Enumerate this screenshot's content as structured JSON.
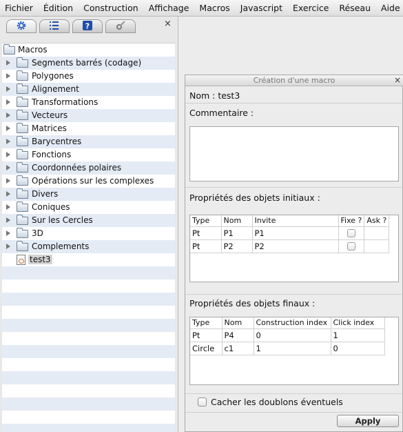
{
  "menubar": [
    "Fichier",
    "Édition",
    "Construction",
    "Affichage",
    "Macros",
    "Javascript",
    "Exercice",
    "Réseau",
    "Aide"
  ],
  "left_panel": {
    "tabs": [
      {
        "icon": "gear-icon",
        "active": true
      },
      {
        "icon": "list-icon",
        "active": false
      },
      {
        "icon": "help-icon",
        "active": false
      },
      {
        "icon": "tools-icon",
        "active": false
      }
    ],
    "close_label": "×",
    "tree": {
      "root": "Macros",
      "folders": [
        "Segments barrés (codage)",
        "Polygones",
        "Alignement",
        "Transformations",
        "Vecteurs",
        "Matrices",
        "Barycentres",
        "Fonctions",
        "Coordonnées polaires",
        "Opérations sur les complexes",
        "Divers",
        "Coniques",
        "Sur les Cercles",
        "3D",
        "Complements"
      ],
      "macro": "test3"
    }
  },
  "dialog": {
    "title": "Création d'une macro",
    "close_label": "×",
    "name_line": "Nom : test3",
    "comment_label": "Commentaire :",
    "comment_value": "",
    "initial_label": "Propriétés des objets initiaux :",
    "initial_table": {
      "headers": [
        "Type",
        "Nom",
        "Invite",
        "Fixe ?",
        "Ask ?"
      ],
      "rows": [
        [
          "Pt",
          "P1",
          "P1"
        ],
        [
          "Pt",
          "P2",
          "P2"
        ]
      ]
    },
    "final_label": "Propriétés des objets finaux :",
    "final_table": {
      "headers": [
        "Type",
        "Nom",
        "Construction index",
        "Click index"
      ],
      "rows": [
        [
          "Pt",
          "P4",
          "0",
          "1"
        ],
        [
          "Circle",
          "c1",
          "1",
          "0"
        ]
      ]
    },
    "hide_duplicates_label": "Cacher les doublons éventuels",
    "hide_duplicates_checked": false,
    "apply_label": "Apply"
  }
}
